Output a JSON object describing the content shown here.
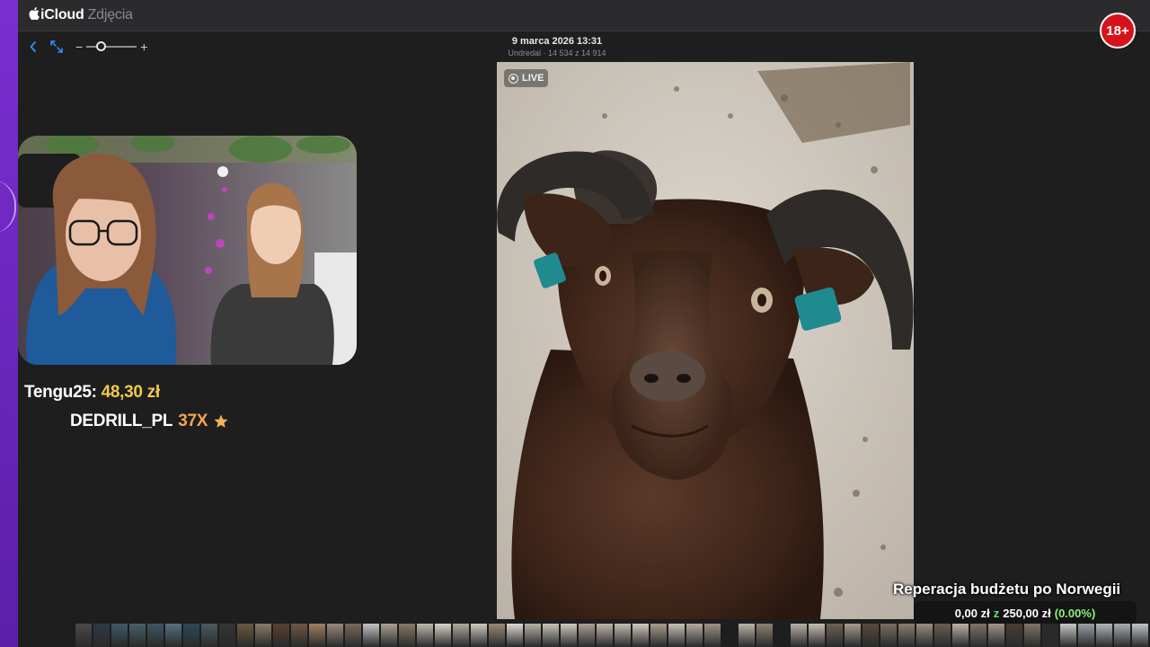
{
  "app": {
    "brand": "iCloud",
    "section": "Zdjęcia"
  },
  "photo": {
    "date": "9 marca 2026 13:31",
    "subtitle": "Undredal · 14 534 z 14 914",
    "live_label": "LIVE"
  },
  "toolbar": {
    "zoom_level": 0.25
  },
  "badge": {
    "age": "18+"
  },
  "donation": {
    "donor": "Tengu25:",
    "amount": "48,30 zł"
  },
  "sub_alert": {
    "name": "DEDRILL_PL",
    "count": "37X"
  },
  "goal": {
    "title": "Reperacja budżetu po Norwegii",
    "current": "0,00 zł",
    "separator": "z",
    "target": "250,00 zł",
    "percent": "(0.00%)"
  },
  "colors": {
    "accent": "#3a8dff",
    "badge": "#d8121b",
    "amount": "#f2c94c",
    "goal_pct": "#8cf27a"
  },
  "filmstrip": {
    "thumbs": [
      "#4a4a4a",
      "#2e3a48",
      "#3f5a66",
      "#48606a",
      "#3d5663",
      "#567080",
      "#2d4a56",
      "#4c5a60",
      "#343434",
      "#6a5a40",
      "#8a7b6a",
      "#5a4030",
      "#6d5747",
      "#a08060",
      "#9a8a7a",
      "#7a6a5a",
      "#c4c4c4",
      "#a9a090",
      "#8a7868",
      "#bfb8ad",
      "#d8d3cb",
      "#b0a89c",
      "#cfc8bd",
      "#9a8a78",
      "#dedad4",
      "#b7b0a6",
      "#c9c2b8",
      "#d0c9bf",
      "#aaa095",
      "#bdb5aa",
      "#c2bcb3",
      "#cfc9c0",
      "#a89c8c",
      "#c8c1b6",
      "#b5ab9f",
      "#9e9386",
      "gap",
      "#bcb4a8",
      "#8d8172",
      "gap",
      "#b7afa4",
      "#c4beb4",
      "#6e6254",
      "#a79c8e",
      "#5a4a3c",
      "#7a6e60",
      "#8a7e70",
      "#9a8e80",
      "#6a5e50",
      "#b9b2a8",
      "#7e7366",
      "#a0968a",
      "#4a3e32",
      "#807466",
      "#2a2a2a",
      "#c8c8c8",
      "#9aa0a8",
      "#b0b6bc",
      "#a8acb0",
      "#c0c4c8",
      "#d0d2d4",
      "#b8bcc0",
      "#9ea4aa",
      "#a6a8ac",
      "#8c9298",
      "#b4b8bc"
    ]
  }
}
